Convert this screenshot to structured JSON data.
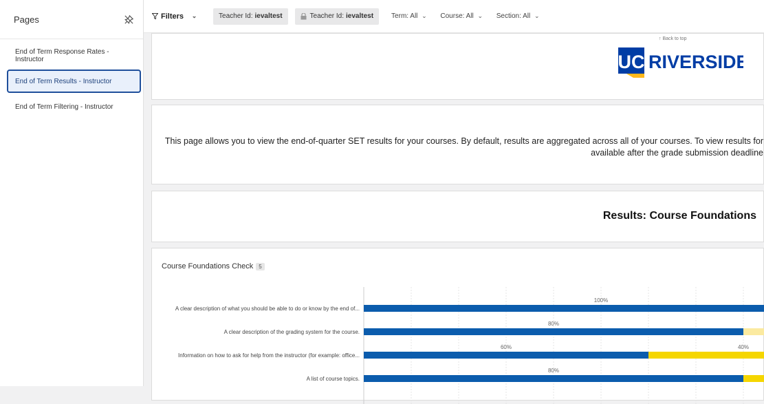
{
  "sidebar": {
    "title": "Pages",
    "items": [
      {
        "label": "End of Term Response Rates - Instructor",
        "active": false
      },
      {
        "label": "End of Term Results - Instructor",
        "active": true
      },
      {
        "label": "End of Term Filtering - Instructor",
        "active": false
      }
    ]
  },
  "topbar": {
    "filters_label": "Filters",
    "chip1": {
      "key": "Teacher Id:",
      "value": "ievaltest"
    },
    "chip2": {
      "key": "Teacher Id:",
      "value": "ievaltest"
    },
    "term": "Term: All",
    "course": "Course: All",
    "section": "Section: All"
  },
  "header": {
    "back_to_top": "↑ Back to top",
    "logo_mark": "UC",
    "logo_word": "RIVERSIDE",
    "brand_blue": "#003da5",
    "brand_gold": "#ffb81c"
  },
  "intro": {
    "line1": "This page allows you to view the end-of-quarter SET results for your courses. By default, results are aggregated across all of your courses. To view results for",
    "line2": "available after the grade submission deadline"
  },
  "section_title": "Results: Course Foundations",
  "widget": {
    "title": "Course Foundations Check",
    "badge": "5"
  },
  "chart_data": {
    "type": "bar",
    "orientation": "horizontal",
    "stacked": true,
    "categories": [
      "A clear description of what you should be able to do or know by the end of...",
      "A clear description of the grading system for the course.",
      "Information on how to ask for help from the instructor (for example: office...",
      "A list of course topics."
    ],
    "series": [
      {
        "values": [
          100,
          80,
          60,
          80
        ],
        "labels": [
          "100%",
          "80%",
          "60%",
          "80%"
        ],
        "color": "#0b5cad"
      },
      {
        "values": [
          0,
          20,
          40,
          20
        ],
        "labels": [
          "",
          "",
          "40%",
          ""
        ],
        "colors": [
          "#f5d600",
          "#fbeaa0",
          "#f5d600",
          "#f5d600"
        ]
      }
    ],
    "xlim": [
      0,
      100
    ],
    "grid": true
  }
}
